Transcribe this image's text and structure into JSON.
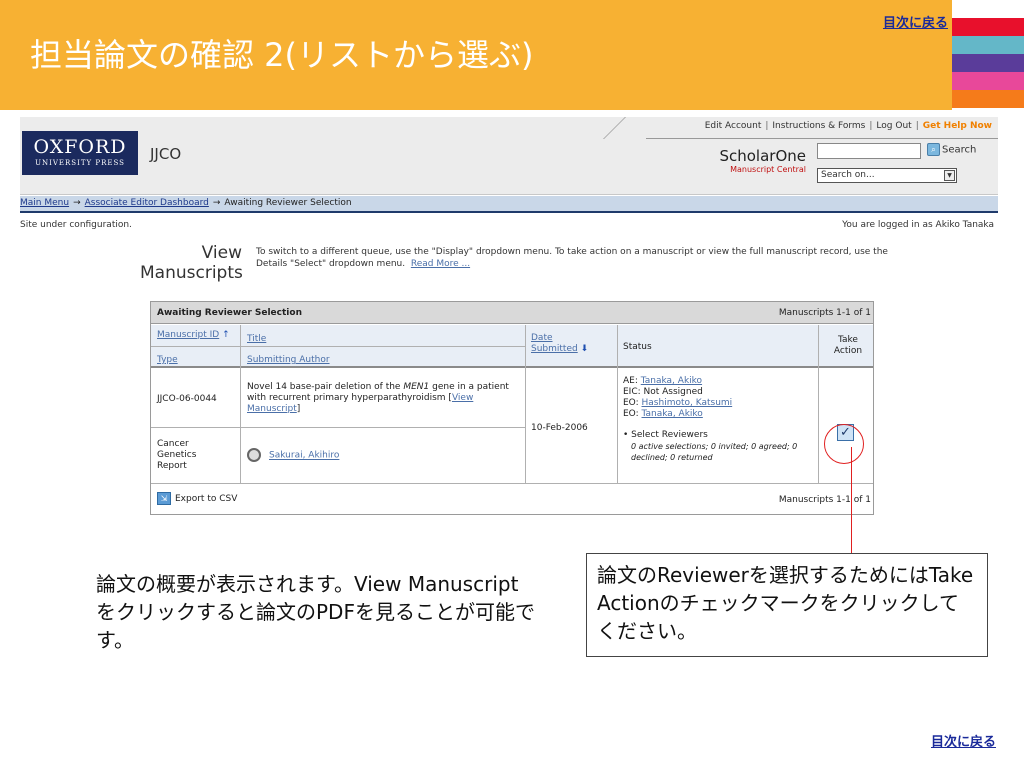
{
  "slide": {
    "title": "担当論文の確認 2(リストから選ぶ)",
    "toc_link_top": "目次に戻る",
    "toc_link_bottom": "目次に戻る",
    "stripe_colors": [
      "#e8102c",
      "#64b7c8",
      "#5a3c9a",
      "#e8489a",
      "#f57b1a"
    ]
  },
  "app": {
    "top_links": {
      "edit_account": "Edit Account",
      "instructions": "Instructions & Forms",
      "log_out": "Log Out",
      "get_help": "Get Help Now"
    },
    "logo": {
      "line1": "OXFORD",
      "line2": "UNIVERSITY PRESS"
    },
    "journal": "JJCO",
    "scholarone": {
      "main": "ScholarOne",
      "sub": "Manuscript Central"
    },
    "search": {
      "button_label": "Search",
      "input_value": "",
      "select_value": "Search on..."
    },
    "breadcrumb": {
      "main_menu": "Main Menu",
      "ae_dashboard": "Associate Editor Dashboard",
      "current": "Awaiting Reviewer Selection",
      "arrow": "→"
    },
    "site_config": "Site under configuration.",
    "logged_in": "You are logged in as Akiko Tanaka",
    "view": {
      "heading1": "View",
      "heading2": "Manuscripts",
      "description": "To switch to a different queue, use the \"Display\" dropdown menu. To take action on a manuscript or view the full manuscript record, use the Details \"Select\" dropdown menu.",
      "read_more": "Read More ..."
    },
    "grid": {
      "title": "Awaiting Reviewer Selection",
      "count": "Manuscripts 1-1 of 1",
      "headers": {
        "manuscript_id": "Manuscript ID",
        "sort_up": "↑",
        "title": "Title",
        "type": "Type",
        "submitting_author": "Submitting Author",
        "date_submitted": "Date Submitted",
        "sort_down": "⬇",
        "status": "Status",
        "take_action": "Take Action"
      },
      "row": {
        "id": "JJCO-06-0044",
        "title_pre": "Novel 14 base-pair deletion of the ",
        "title_gene": "MEN1",
        "title_post": " gene in a patient with recurrent primary hyperparathyroidism [",
        "view_manuscript": "View Manuscript",
        "title_close": "]",
        "type": "Cancer Genetics Report",
        "author": "Sakurai, Akihiro",
        "date": "10-Feb-2006",
        "status": {
          "ae_label": "AE: ",
          "ae_name": "Tanaka, Akiko",
          "eic": "EIC: Not Assigned",
          "eo1_label": "EO: ",
          "eo1_name": "Hashimoto, Katsumi",
          "eo2_label": "EO: ",
          "eo2_name": "Tanaka, Akiko",
          "action": "• Select Reviewers",
          "counts": "0 active selections; 0 invited; 0 agreed; 0 declined; 0 returned"
        },
        "checkbox_glyph": "✓"
      },
      "export": "Export to CSV",
      "footer_count": "Manuscripts 1-1 of 1"
    }
  },
  "captions": {
    "left": "論文の概要が表示されます。View Manuscriptをクリックすると論文のPDFを見ることが可能です。",
    "callout": "論文のReviewerを選択するためにはTake Actionのチェックマークをクリックしてください。"
  }
}
